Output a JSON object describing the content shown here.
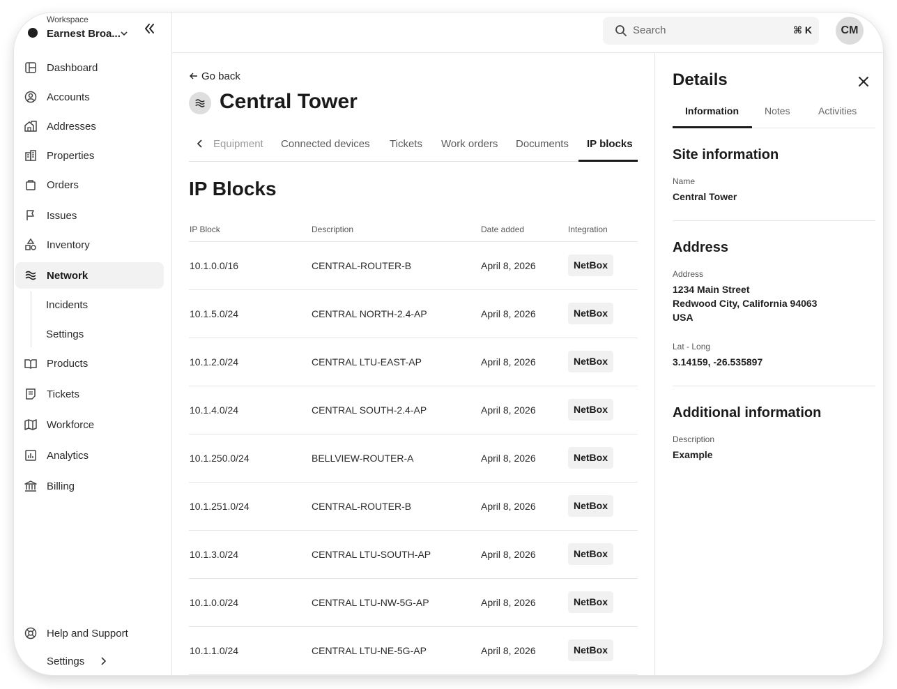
{
  "workspace": {
    "label": "Workspace",
    "name": "Earnest Broa..."
  },
  "sidebar": {
    "items": [
      {
        "label": "Dashboard"
      },
      {
        "label": "Accounts"
      },
      {
        "label": "Addresses"
      },
      {
        "label": "Properties"
      },
      {
        "label": "Orders"
      },
      {
        "label": "Issues"
      },
      {
        "label": "Inventory"
      },
      {
        "label": "Network"
      },
      {
        "label": "Products"
      },
      {
        "label": "Tickets"
      },
      {
        "label": "Workforce"
      },
      {
        "label": "Analytics"
      },
      {
        "label": "Billing"
      }
    ],
    "network_sub": [
      {
        "label": "Incidents"
      },
      {
        "label": "Settings"
      }
    ],
    "footer": {
      "help": "Help and Support",
      "settings": "Settings"
    }
  },
  "topbar": {
    "search_placeholder": "Search",
    "search_shortcut": "⌘ K",
    "avatar_initials": "CM"
  },
  "page": {
    "go_back": "Go back",
    "title": "Central Tower",
    "tabs": [
      {
        "label": "Equipment"
      },
      {
        "label": "Connected devices"
      },
      {
        "label": "Tickets"
      },
      {
        "label": "Work orders"
      },
      {
        "label": "Documents"
      },
      {
        "label": "IP blocks"
      }
    ],
    "active_tab": "IP blocks",
    "section_title": "IP Blocks"
  },
  "table": {
    "headers": [
      "IP Block",
      "Description",
      "Date added",
      "Integration"
    ],
    "rows": [
      {
        "ip": "10.1.0.0/16",
        "desc": "CENTRAL-ROUTER-B",
        "date": "April 8, 2026",
        "integration": "NetBox"
      },
      {
        "ip": "10.1.5.0/24",
        "desc": "CENTRAL NORTH-2.4-AP",
        "date": "April 8, 2026",
        "integration": "NetBox"
      },
      {
        "ip": "10.1.2.0/24",
        "desc": "CENTRAL LTU-EAST-AP",
        "date": "April 8, 2026",
        "integration": "NetBox"
      },
      {
        "ip": "10.1.4.0/24",
        "desc": "CENTRAL SOUTH-2.4-AP",
        "date": "April 8, 2026",
        "integration": "NetBox"
      },
      {
        "ip": "10.1.250.0/24",
        "desc": "BELLVIEW-ROUTER-A",
        "date": "April 8, 2026",
        "integration": "NetBox"
      },
      {
        "ip": "10.1.251.0/24",
        "desc": "CENTRAL-ROUTER-B",
        "date": "April 8, 2026",
        "integration": "NetBox"
      },
      {
        "ip": "10.1.3.0/24",
        "desc": "CENTRAL LTU-SOUTH-AP",
        "date": "April 8, 2026",
        "integration": "NetBox"
      },
      {
        "ip": "10.1.0.0/24",
        "desc": "CENTRAL LTU-NW-5G-AP",
        "date": "April 8, 2026",
        "integration": "NetBox"
      },
      {
        "ip": "10.1.1.0/24",
        "desc": "CENTRAL LTU-NE-5G-AP",
        "date": "April 8, 2026",
        "integration": "NetBox"
      }
    ]
  },
  "details": {
    "title": "Details",
    "tabs": [
      {
        "label": "Information"
      },
      {
        "label": "Notes"
      },
      {
        "label": "Activities"
      }
    ],
    "site_info": {
      "heading": "Site information",
      "name_label": "Name",
      "name_value": "Central Tower"
    },
    "address": {
      "heading": "Address",
      "address_label": "Address",
      "line1": "1234 Main Street",
      "line2": "Redwood City, California 94063",
      "line3": "USA",
      "latlong_label": "Lat - Long",
      "latlong_value": "3.14159, -26.535897"
    },
    "additional": {
      "heading": "Additional information",
      "desc_label": "Description",
      "desc_value": "Example"
    }
  }
}
